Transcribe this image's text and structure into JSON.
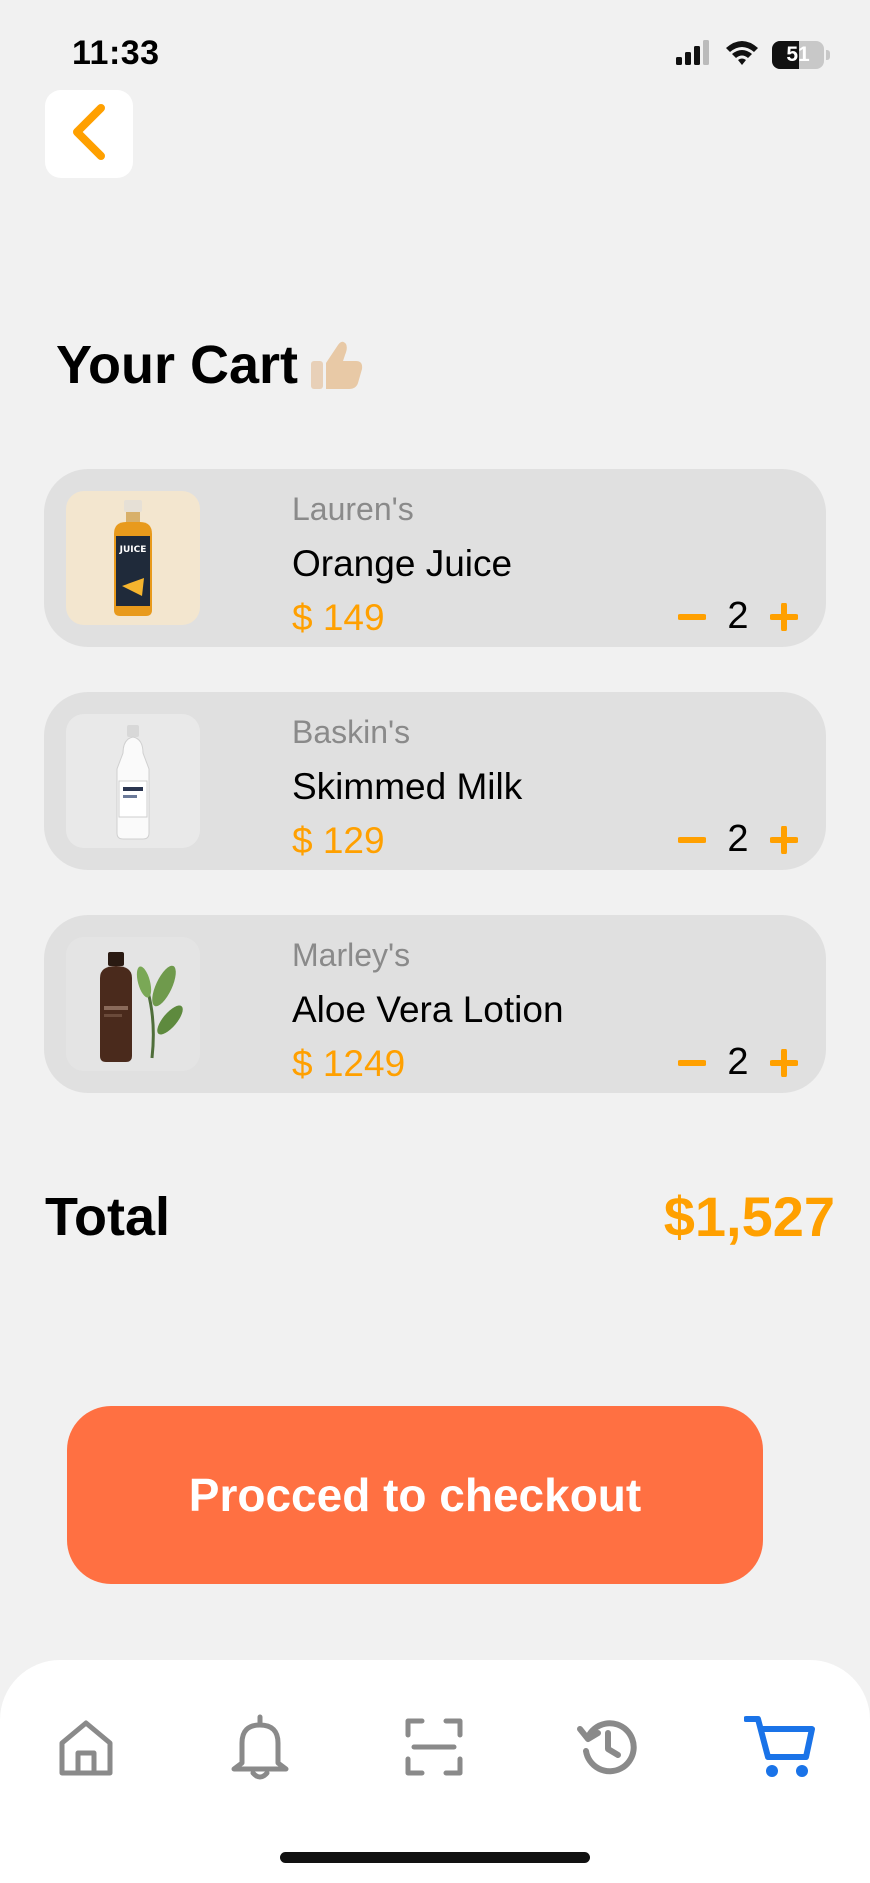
{
  "status_bar": {
    "time": "11:33",
    "battery_level": "51"
  },
  "header": {
    "title": "Your Cart",
    "back_icon": "chevron-left-icon"
  },
  "cart": {
    "items": [
      {
        "brand": "Lauren's",
        "name": "Orange Juice",
        "price": "$ 149",
        "quantity": "2",
        "image": "juice-bottle-image"
      },
      {
        "brand": "Baskin's",
        "name": "Skimmed Milk",
        "price": "$ 129",
        "quantity": "2",
        "image": "milk-bottle-image"
      },
      {
        "brand": "Marley's",
        "name": "Aloe Vera Lotion",
        "price": "$ 1249",
        "quantity": "2",
        "image": "lotion-bottle-image"
      }
    ]
  },
  "total": {
    "label": "Total",
    "value": "$1,527"
  },
  "checkout": {
    "label": "Procced to checkout"
  },
  "tab_bar": {
    "items": [
      "home-icon",
      "bell-icon",
      "scan-icon",
      "history-icon",
      "cart-icon"
    ],
    "active": "cart-icon"
  },
  "colors": {
    "accent": "#ffa000",
    "checkout": "#ff7042",
    "active_tab": "#1a73e8",
    "inactive_tab": "#8a8a8a",
    "card": "#e0e0e0",
    "background": "#f1f1f1"
  }
}
